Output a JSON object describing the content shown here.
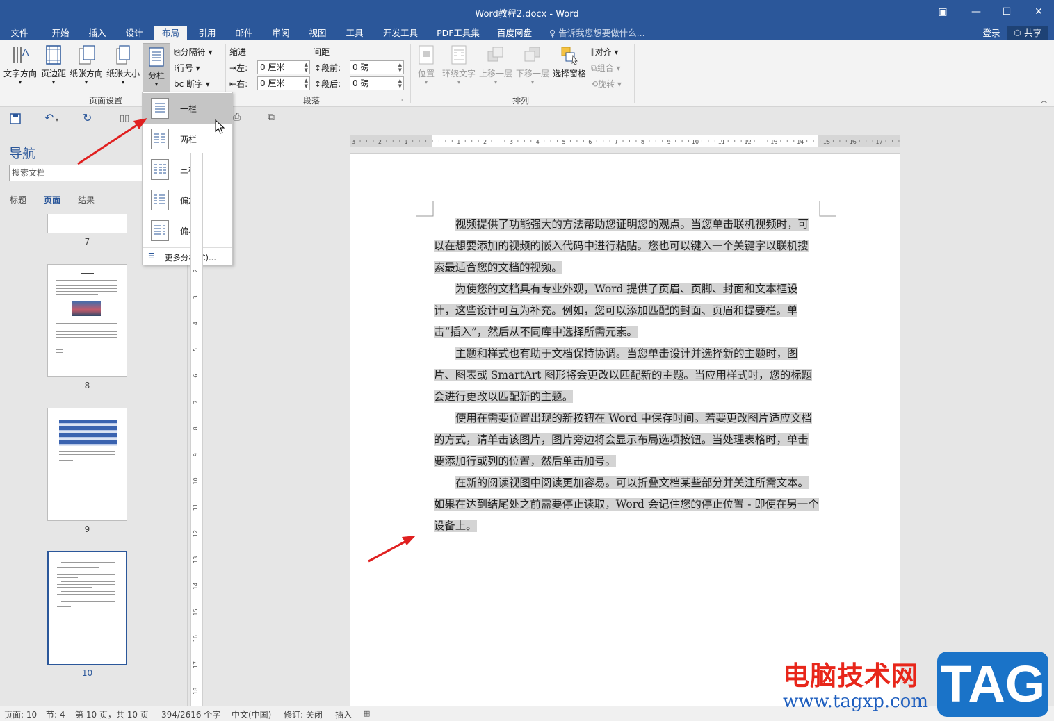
{
  "window": {
    "title": "Word教程2.docx - Word"
  },
  "tabs": [
    "文件",
    "开始",
    "插入",
    "设计",
    "布局",
    "引用",
    "邮件",
    "审阅",
    "视图",
    "工具",
    "开发工具",
    "PDF工具集",
    "百度网盘"
  ],
  "tell_me": "告诉我您想要做什么...",
  "account": {
    "login": "登录",
    "share": "共享"
  },
  "ribbon": {
    "page_setup": {
      "text_direction": "文字方向",
      "margins": "页边距",
      "orientation": "纸张方向",
      "size": "纸张大小",
      "columns": "分栏",
      "breaks": "分隔符",
      "line_numbers": "行号",
      "hyphenation": "断字",
      "label": "页面设置"
    },
    "paragraph": {
      "indent": "缩进",
      "spacing": "间距",
      "left": "左:",
      "right": "右:",
      "before": "段前:",
      "after": "段后:",
      "left_val": "0 厘米",
      "right_val": "0 厘米",
      "before_val": "0 磅",
      "after_val": "0 磅",
      "label": "段落"
    },
    "arrange": {
      "position": "位置",
      "wrap": "环绕文字",
      "forward": "上移一层",
      "backward": "下移一层",
      "selection_pane": "选择窗格",
      "align": "对齐",
      "group": "组合",
      "rotate": "旋转",
      "label": "排列"
    }
  },
  "columns_menu": {
    "one": "一栏",
    "two": "两栏",
    "three": "三栏",
    "left": "偏左",
    "right": "偏右",
    "more": "更多分栏(C)..."
  },
  "nav": {
    "title": "导航",
    "search_placeholder": "搜索文档",
    "tabs": [
      "标题",
      "页面",
      "结果"
    ],
    "pages": [
      "7",
      "8",
      "9",
      "10"
    ]
  },
  "ruler": {
    "h_ticks": [
      "3",
      "2",
      "1",
      "1",
      "2",
      "3",
      "4",
      "5",
      "6",
      "7",
      "8",
      "9",
      "10",
      "11",
      "12",
      "13",
      "14",
      "15",
      "16",
      "17"
    ],
    "v_ticks": [
      "2",
      "3",
      "4",
      "5",
      "6",
      "7",
      "8",
      "9",
      "10",
      "11",
      "12",
      "13",
      "14",
      "15",
      "16",
      "17",
      "18"
    ]
  },
  "document": {
    "paragraphs": [
      "视频提供了功能强大的方法帮助您证明您的观点。当您单击联机视频时，可以在想要添加的视频的嵌入代码中进行粘贴。您也可以键入一个关键字以联机搜索最适合您的文档的视频。",
      "为使您的文档具有专业外观，Word 提供了页眉、页脚、封面和文本框设计，这些设计可互为补充。例如，您可以添加匹配的封面、页眉和提要栏。单击“插入”，然后从不同库中选择所需元素。",
      "主题和样式也有助于文档保持协调。当您单击设计并选择新的主题时，图片、图表或 SmartArt 图形将会更改以匹配新的主题。当应用样式时，您的标题会进行更改以匹配新的主题。",
      "使用在需要位置出现的新按钮在 Word 中保存时间。若要更改图片适应文档的方式，请单击该图片，图片旁边将会显示布局选项按钮。当处理表格时，单击要添加行或列的位置，然后单击加号。",
      "在新的阅读视图中阅读更加容易。可以折叠文档某些部分并关注所需文本。如果在达到结尾处之前需要停止读取，Word 会记住您的停止位置 - 即使在另一个设备上。"
    ]
  },
  "status": {
    "page": "页面: 10",
    "section": "节: 4",
    "pages": "第 10 页，共 10 页",
    "words": "394/2616 个字",
    "lang": "中文(中国)",
    "track": "修订: 关闭",
    "insert": "插入"
  },
  "watermark": {
    "site_cn": "电脑技术网",
    "url": "www.tagxp.com",
    "tag": "TAG"
  },
  "colors": {
    "accent": "#2b579a",
    "selection": "#d4d4d4",
    "arrow": "#e02020"
  }
}
